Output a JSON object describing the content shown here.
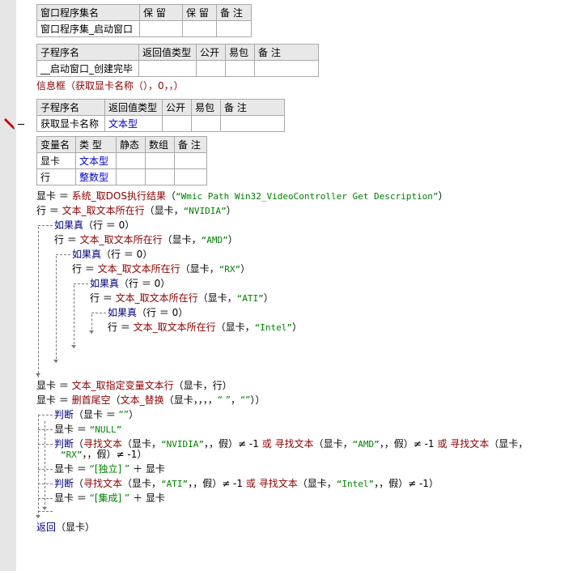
{
  "tables": {
    "assembly": {
      "headers": [
        "窗口程序集名",
        "保 留",
        "保 留",
        "备 注"
      ],
      "row": [
        "窗口程序集_启动窗口",
        "",
        "",
        ""
      ]
    },
    "sub1": {
      "headers": [
        "子程序名",
        "返回值类型",
        "公开",
        "易包",
        "备 注"
      ],
      "row": [
        "__启动窗口_创建完毕",
        "",
        "",
        "",
        ""
      ]
    },
    "sub2": {
      "headers": [
        "子程序名",
        "返回值类型",
        "公开",
        "易包",
        "备 注"
      ],
      "row": [
        "获取显卡名称",
        "文本型",
        "",
        "",
        ""
      ]
    },
    "vars": {
      "headers": [
        "变量名",
        "类 型",
        "静态",
        "数组",
        "备 注"
      ],
      "rows": [
        [
          "显卡",
          "文本型",
          "",
          "",
          ""
        ],
        [
          "行",
          "整数型",
          "",
          "",
          ""
        ]
      ]
    }
  },
  "code": {
    "msgbox_line": "信息框（获取显卡名称（），0，，）",
    "l1a": "显卡 ＝ ",
    "l1b": "系统_取DOS执行结果",
    "l1c": "（",
    "l1d": "“Wmic Path Win32_VideoController Get Description”",
    "l1e": "）",
    "l2a": "行 ＝ ",
    "l2b": "文本_取文本所在行",
    "l2c": "（显卡，",
    "l2d": "“NVIDIA”",
    "l2e": "）",
    "l3a": "如果真",
    "l3b": "（行 ＝ 0）",
    "l4a": "行 ＝ ",
    "l4b": "文本_取文本所在行",
    "l4c": "（显卡，",
    "l4d": "“AMD”",
    "l4e": "）",
    "l5a": "如果真",
    "l5b": "（行 ＝ 0）",
    "l6a": "行 ＝ ",
    "l6b": "文本_取文本所在行",
    "l6c": "（显卡，",
    "l6d": "“RX”",
    "l6e": "）",
    "l7a": "如果真",
    "l7b": "（行 ＝ 0）",
    "l8a": "行 ＝ ",
    "l8b": "文本_取文本所在行",
    "l8c": "（显卡，",
    "l8d": "“ATI”",
    "l8e": "）",
    "l9a": "如果真",
    "l9b": "（行 ＝ 0）",
    "l10a": "行 ＝ ",
    "l10b": "文本_取文本所在行",
    "l10c": "（显卡，",
    "l10d": "“Intel”",
    "l10e": "）",
    "l11a": "显卡 ＝ ",
    "l11b": "文本_取指定变量文本行",
    "l11c": "（显卡，行）",
    "l12a": "显卡 ＝ ",
    "l12b": "删首尾空",
    "l12c": "（",
    "l12d": "文本_替换",
    "l12e": "（显卡，，，，",
    "l12f": "“           ”",
    "l12g": "，",
    "l12h": "“”",
    "l12i": "））",
    "l13a": "判断",
    "l13b": "（显卡 ＝ ",
    "l13c": "“”",
    "l13d": "）",
    "l14a": "显卡 ＝ ",
    "l14b": "“NULL”",
    "l15a": "判断",
    "l15b": "（",
    "l15c": "寻找文本",
    "l15d": "（显卡，",
    "l15e": "“NVIDIA”",
    "l15f": "，，假）≠ -1 ",
    "l15g": "或",
    "l15h": " ",
    "l15i": "寻找文本",
    "l15j": "（显卡，",
    "l15k": "“AMD”",
    "l15l": "，，假）≠ -1 ",
    "l15m": "或",
    "l15n": " ",
    "l15o": "寻找文本",
    "l15p": "（显卡，",
    "l15q": "“RX”",
    "l15r": "，，假）≠ -1）",
    "l16a": "显卡 ＝ ",
    "l16b": "“[独立] ”",
    "l16c": " ＋ 显卡",
    "l17a": "判断",
    "l17b": "（",
    "l17c": "寻找文本",
    "l17d": "（显卡，",
    "l17e": "“ATI”",
    "l17f": "，，假）≠ -1 ",
    "l17g": "或",
    "l17h": " ",
    "l17i": "寻找文本",
    "l17j": "（显卡，",
    "l17k": "“Intel”",
    "l17l": "，，假）≠ -1）",
    "l18a": "显卡 ＝ ",
    "l18b": "“[集成] ”",
    "l18c": " ＋ 显卡",
    "l19a": "返回",
    "l19b": "（显卡）"
  }
}
